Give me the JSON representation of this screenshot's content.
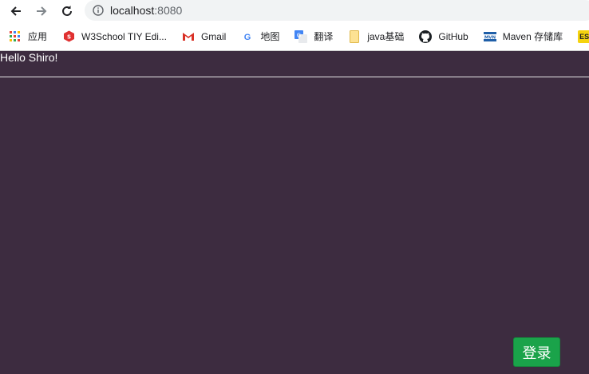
{
  "browser": {
    "url_host": "localhost",
    "url_port": ":8080"
  },
  "bookmarks": [
    {
      "label": "应用",
      "icon": "apps-grid-icon"
    },
    {
      "label": "W3School TIY Edi...",
      "icon": "w3school-icon"
    },
    {
      "label": "Gmail",
      "icon": "gmail-icon"
    },
    {
      "label": "地图",
      "icon": "google-icon"
    },
    {
      "label": "翻译",
      "icon": "translate-icon"
    },
    {
      "label": "java基础",
      "icon": "folder-icon"
    },
    {
      "label": "GitHub",
      "icon": "github-icon"
    },
    {
      "label": "Maven 存储库",
      "icon": "maven-icon"
    },
    {
      "label": "",
      "icon": "es-icon",
      "badge": "ES"
    }
  ],
  "page": {
    "greeting": "Hello Shiro!",
    "login_label": "登录"
  },
  "colors": {
    "page_background": "#3d2c40",
    "login_button": "#1aa34a"
  }
}
